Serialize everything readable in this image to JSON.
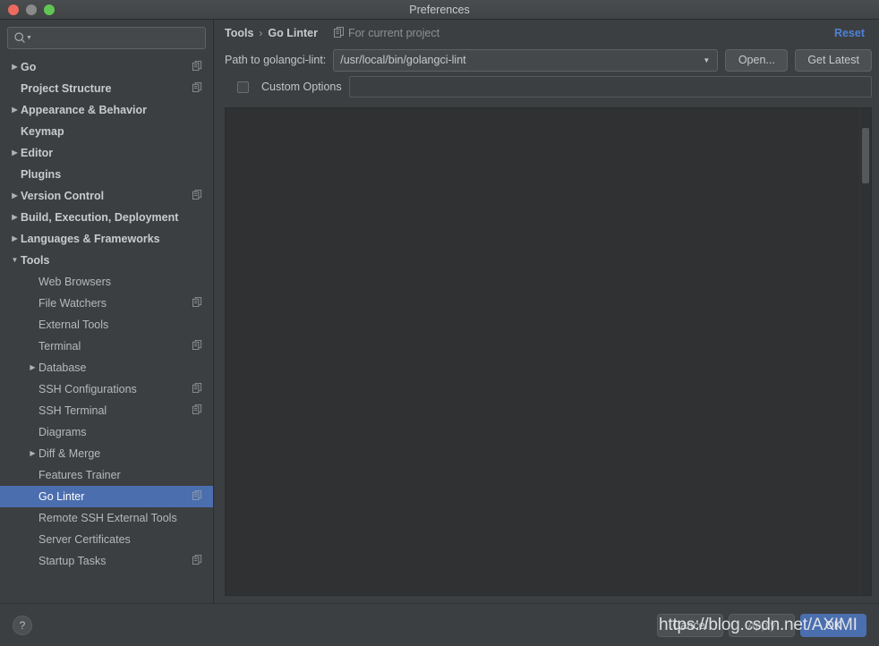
{
  "window": {
    "title": "Preferences",
    "traffic_lights": [
      "close-red",
      "minimize-gray",
      "zoom-green"
    ]
  },
  "sidebar": {
    "search": {
      "value": "",
      "placeholder": ""
    },
    "items": [
      {
        "label": "Go",
        "level": 0,
        "arrow": "collapsed",
        "bold": true,
        "project_icon": true,
        "selected": false
      },
      {
        "label": "Project Structure",
        "level": 0,
        "arrow": "none",
        "bold": true,
        "project_icon": true,
        "selected": false
      },
      {
        "label": "Appearance & Behavior",
        "level": 0,
        "arrow": "collapsed",
        "bold": true,
        "project_icon": false,
        "selected": false
      },
      {
        "label": "Keymap",
        "level": 0,
        "arrow": "none",
        "bold": true,
        "project_icon": false,
        "selected": false
      },
      {
        "label": "Editor",
        "level": 0,
        "arrow": "collapsed",
        "bold": true,
        "project_icon": false,
        "selected": false
      },
      {
        "label": "Plugins",
        "level": 0,
        "arrow": "none",
        "bold": true,
        "project_icon": false,
        "selected": false
      },
      {
        "label": "Version Control",
        "level": 0,
        "arrow": "collapsed",
        "bold": true,
        "project_icon": true,
        "selected": false
      },
      {
        "label": "Build, Execution, Deployment",
        "level": 0,
        "arrow": "collapsed",
        "bold": true,
        "project_icon": false,
        "selected": false
      },
      {
        "label": "Languages & Frameworks",
        "level": 0,
        "arrow": "collapsed",
        "bold": true,
        "project_icon": false,
        "selected": false
      },
      {
        "label": "Tools",
        "level": 0,
        "arrow": "expanded",
        "bold": true,
        "project_icon": false,
        "selected": false
      },
      {
        "label": "Web Browsers",
        "level": 1,
        "arrow": "none",
        "bold": false,
        "project_icon": false,
        "selected": false
      },
      {
        "label": "File Watchers",
        "level": 1,
        "arrow": "none",
        "bold": false,
        "project_icon": true,
        "selected": false
      },
      {
        "label": "External Tools",
        "level": 1,
        "arrow": "none",
        "bold": false,
        "project_icon": false,
        "selected": false
      },
      {
        "label": "Terminal",
        "level": 1,
        "arrow": "none",
        "bold": false,
        "project_icon": true,
        "selected": false
      },
      {
        "label": "Database",
        "level": 1,
        "arrow": "collapsed",
        "bold": false,
        "project_icon": false,
        "selected": false
      },
      {
        "label": "SSH Configurations",
        "level": 1,
        "arrow": "none",
        "bold": false,
        "project_icon": true,
        "selected": false
      },
      {
        "label": "SSH Terminal",
        "level": 1,
        "arrow": "none",
        "bold": false,
        "project_icon": true,
        "selected": false
      },
      {
        "label": "Diagrams",
        "level": 1,
        "arrow": "none",
        "bold": false,
        "project_icon": false,
        "selected": false
      },
      {
        "label": "Diff & Merge",
        "level": 1,
        "arrow": "collapsed",
        "bold": false,
        "project_icon": false,
        "selected": false
      },
      {
        "label": "Features Trainer",
        "level": 1,
        "arrow": "none",
        "bold": false,
        "project_icon": false,
        "selected": false
      },
      {
        "label": "Go Linter",
        "level": 1,
        "arrow": "none",
        "bold": false,
        "project_icon": true,
        "selected": true
      },
      {
        "label": "Remote SSH External Tools",
        "level": 1,
        "arrow": "none",
        "bold": false,
        "project_icon": false,
        "selected": false
      },
      {
        "label": "Server Certificates",
        "level": 1,
        "arrow": "none",
        "bold": false,
        "project_icon": false,
        "selected": false
      },
      {
        "label": "Startup Tasks",
        "level": 1,
        "arrow": "none",
        "bold": false,
        "project_icon": true,
        "selected": false
      }
    ]
  },
  "content": {
    "breadcrumb": {
      "parent": "Tools",
      "separator": "›",
      "current": "Go Linter"
    },
    "scope_label": "For current project",
    "reset_label": "Reset",
    "path_row": {
      "label": "Path to golangci-lint:",
      "value": "/usr/local/bin/golangci-lint",
      "open_button": "Open...",
      "get_latest_button": "Get Latest"
    },
    "custom_options": {
      "label": "Custom Options",
      "checked": false,
      "value": "",
      "placeholder": ""
    }
  },
  "footer": {
    "help_label": "?",
    "cancel_label": "Cancel",
    "apply_label": "Apply",
    "ok_label": "OK"
  },
  "watermark": {
    "text": "https://blog.csdn.net/AXIMI"
  },
  "colors": {
    "window_bg": "#3c3f41",
    "panel_bg": "#2f3133",
    "selection_blue": "#4b6eaf",
    "link_blue": "#4d81d6",
    "text": "#bbbbbb",
    "border": "#2b2b2b"
  }
}
